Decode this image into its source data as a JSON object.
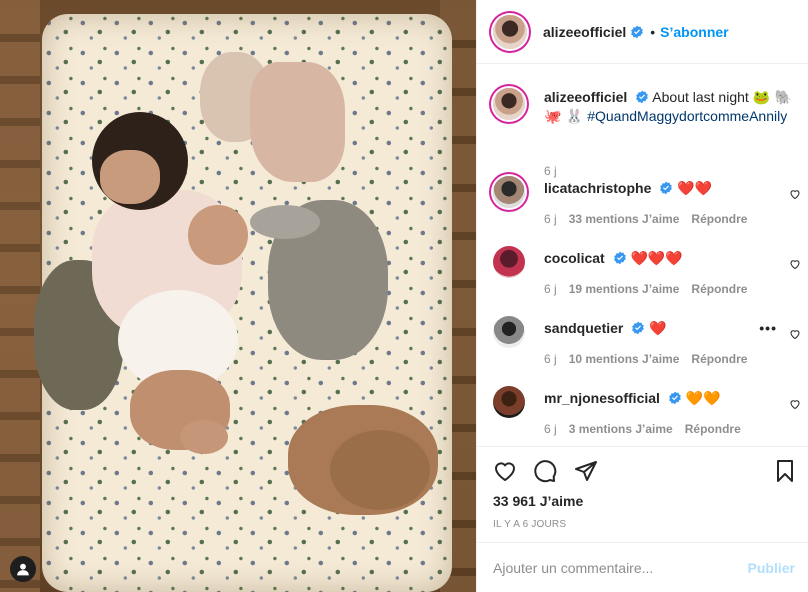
{
  "post": {
    "author": "alizeeofficiel",
    "follow_label": "S’abonner",
    "dot": "•"
  },
  "caption": {
    "username": "alizeeofficiel",
    "text": "About last night",
    "emojis_1": "🐸 🐘",
    "emojis_2": "🐙 🐰",
    "hashtag": "#QuandMaggydortcommeAnnily",
    "time": "6 j"
  },
  "comments": [
    {
      "username": "licatachristophe",
      "text": "❤️❤️",
      "time": "6 j",
      "likes": "33 mentions J’aime",
      "reply": "Répondre"
    },
    {
      "username": "cocolicat",
      "text": "❤️❤️❤️",
      "time": "6 j",
      "likes": "19 mentions J’aime",
      "reply": "Répondre"
    },
    {
      "username": "sandquetier",
      "text": "❤️",
      "time": "6 j",
      "likes": "10 mentions J’aime",
      "reply": "Répondre",
      "more": "•••"
    },
    {
      "username": "mr_njonesofficial",
      "text": "🧡🧡",
      "time": "6 j",
      "likes": "3 mentions J’aime",
      "reply": "Répondre"
    }
  ],
  "stats": {
    "likes": "33 961 J’aime",
    "ago": "IL Y A 6 JOURS"
  },
  "composer": {
    "placeholder": "Ajouter un commentaire...",
    "publish": "Publier"
  },
  "colors": {
    "accent": "#0095f6",
    "verified": "#3897f0",
    "hashtag": "#00376b",
    "muted": "#8e8e8e",
    "publish_disabled": "#b2dffc"
  }
}
